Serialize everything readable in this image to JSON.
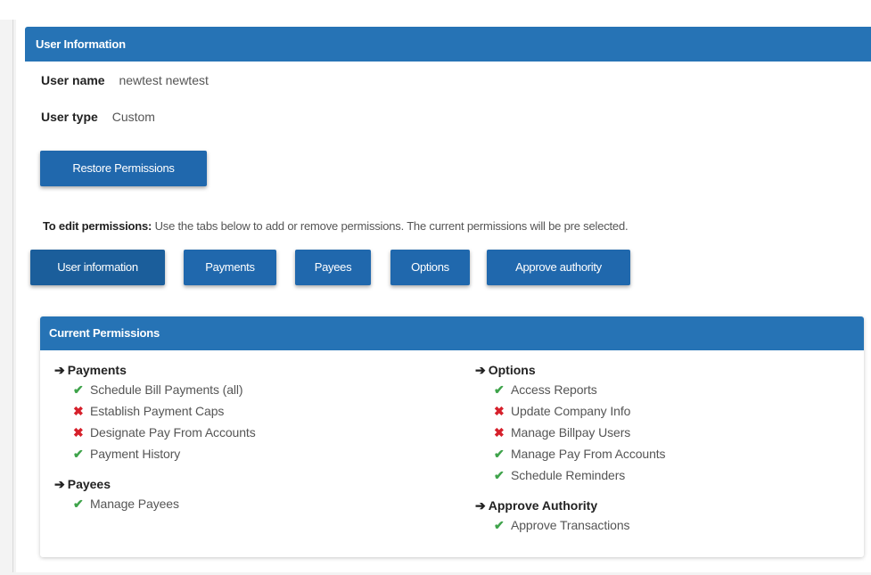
{
  "user_info": {
    "header": "User Information",
    "username_label": "User name",
    "username_value": "newtest newtest",
    "usertype_label": "User type",
    "usertype_value": "Custom",
    "restore_button": "Restore Permissions"
  },
  "edit_note": {
    "bold": "To edit permissions:",
    "text": " Use the tabs below to add or remove permissions. The current permissions will be pre selected."
  },
  "tabs": [
    {
      "label": "User information"
    },
    {
      "label": "Payments"
    },
    {
      "label": "Payees"
    },
    {
      "label": "Options"
    },
    {
      "label": "Approve authority"
    }
  ],
  "permissions": {
    "header": "Current Permissions",
    "colors": {
      "granted": "#3ea34a",
      "denied": "#d6202b",
      "header_bg": "#2673b5"
    },
    "groups": [
      {
        "title": "Payments",
        "items": [
          {
            "label": "Schedule Bill Payments (all)",
            "granted": true
          },
          {
            "label": "Establish Payment Caps",
            "granted": false
          },
          {
            "label": "Designate Pay From Accounts",
            "granted": false
          },
          {
            "label": "Payment History",
            "granted": true
          }
        ]
      },
      {
        "title": "Payees",
        "items": [
          {
            "label": "Manage Payees",
            "granted": true
          }
        ]
      },
      {
        "title": "Options",
        "items": [
          {
            "label": "Access Reports",
            "granted": true
          },
          {
            "label": "Update Company Info",
            "granted": false
          },
          {
            "label": "Manage Billpay Users",
            "granted": false
          },
          {
            "label": "Manage Pay From Accounts",
            "granted": true
          },
          {
            "label": "Schedule Reminders",
            "granted": true
          }
        ]
      },
      {
        "title": "Approve Authority",
        "items": [
          {
            "label": "Approve Transactions",
            "granted": true
          }
        ]
      }
    ]
  }
}
